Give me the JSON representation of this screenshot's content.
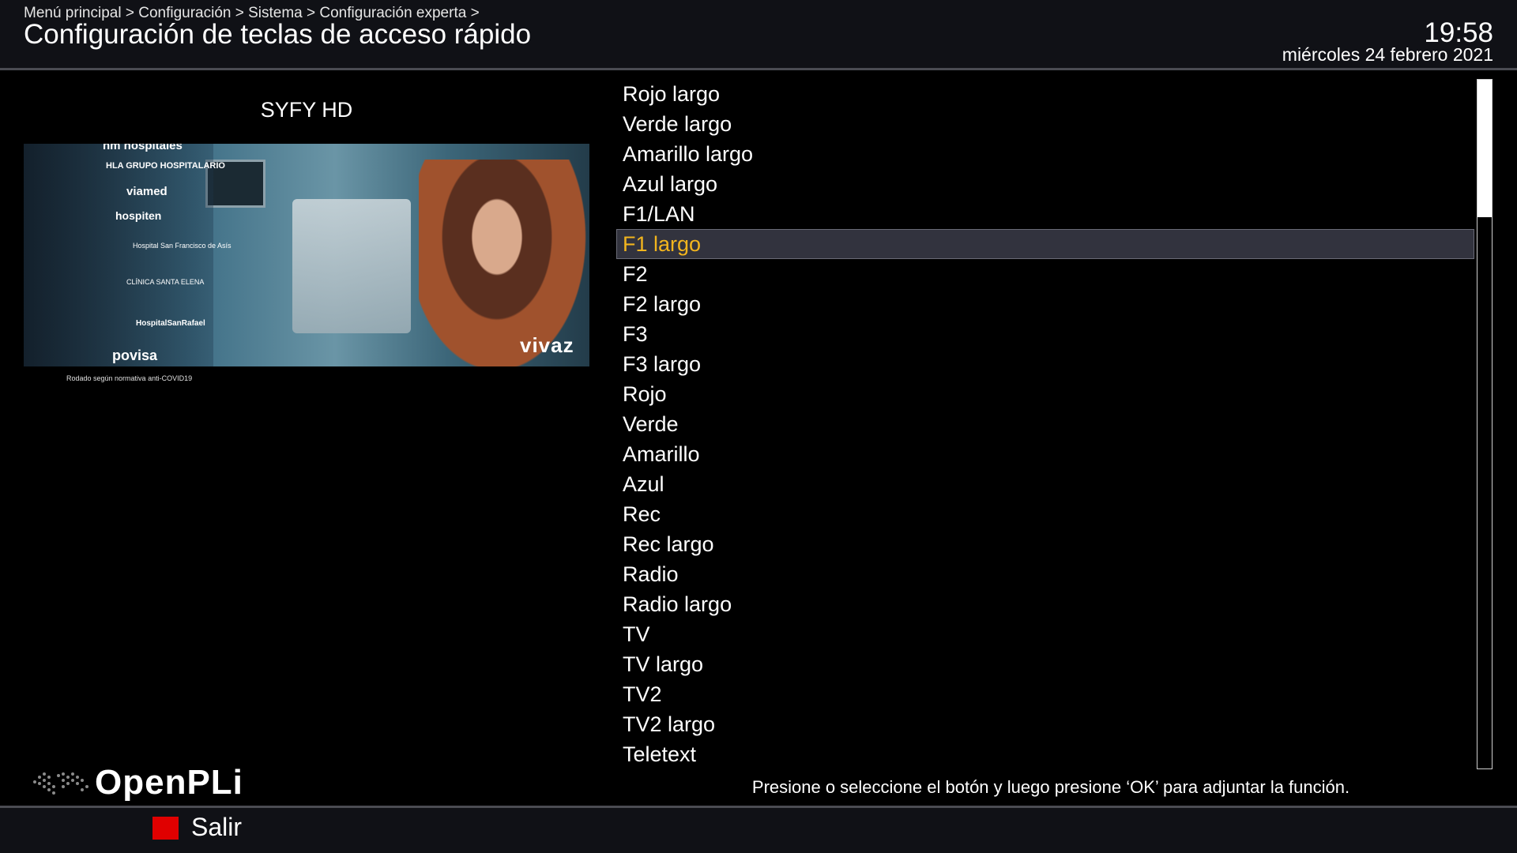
{
  "header": {
    "breadcrumb": "Menú principal > Configuración > Sistema > Configuración experta >",
    "title": "Configuración de teclas de acceso rápido",
    "clock": "19:58",
    "date": "miércoles 24 febrero 2021"
  },
  "preview": {
    "channel": "SYFY HD",
    "sponsors": [
      "hm hospitales",
      "HLA GRUPO HOSPITALARIO",
      "viamed",
      "hospiten",
      "Hospital San Francisco de Asís",
      "CLÍNICA SANTA ELENA",
      "HospitalSanRafael",
      "povisa"
    ],
    "logo": "vivaz",
    "note": "Rodado según normativa anti-COVID19"
  },
  "brand": {
    "name": "OpenPLi"
  },
  "hotkeys": {
    "selected_index": 5,
    "items": [
      "Rojo largo",
      "Verde largo",
      "Amarillo largo",
      "Azul largo",
      "F1/LAN",
      "F1 largo",
      "F2",
      "F2 largo",
      "F3",
      "F3 largo",
      "Rojo",
      "Verde",
      "Amarillo",
      "Azul",
      "Rec",
      "Rec largo",
      "Radio",
      "Radio largo",
      "TV",
      "TV largo",
      "TV2",
      "TV2 largo",
      "Teletext"
    ]
  },
  "scrollbar": {
    "visible_fraction": 0.2
  },
  "help": "Presione o seleccione el botón y luego presione ‘OK’ para adjuntar la función.",
  "footer": {
    "exit_label": "Salir",
    "exit_key_color": "#e00000"
  },
  "colors": {
    "selected_text": "#f2b51e",
    "selected_bg": "#32333e",
    "header_bg": "#101116"
  }
}
